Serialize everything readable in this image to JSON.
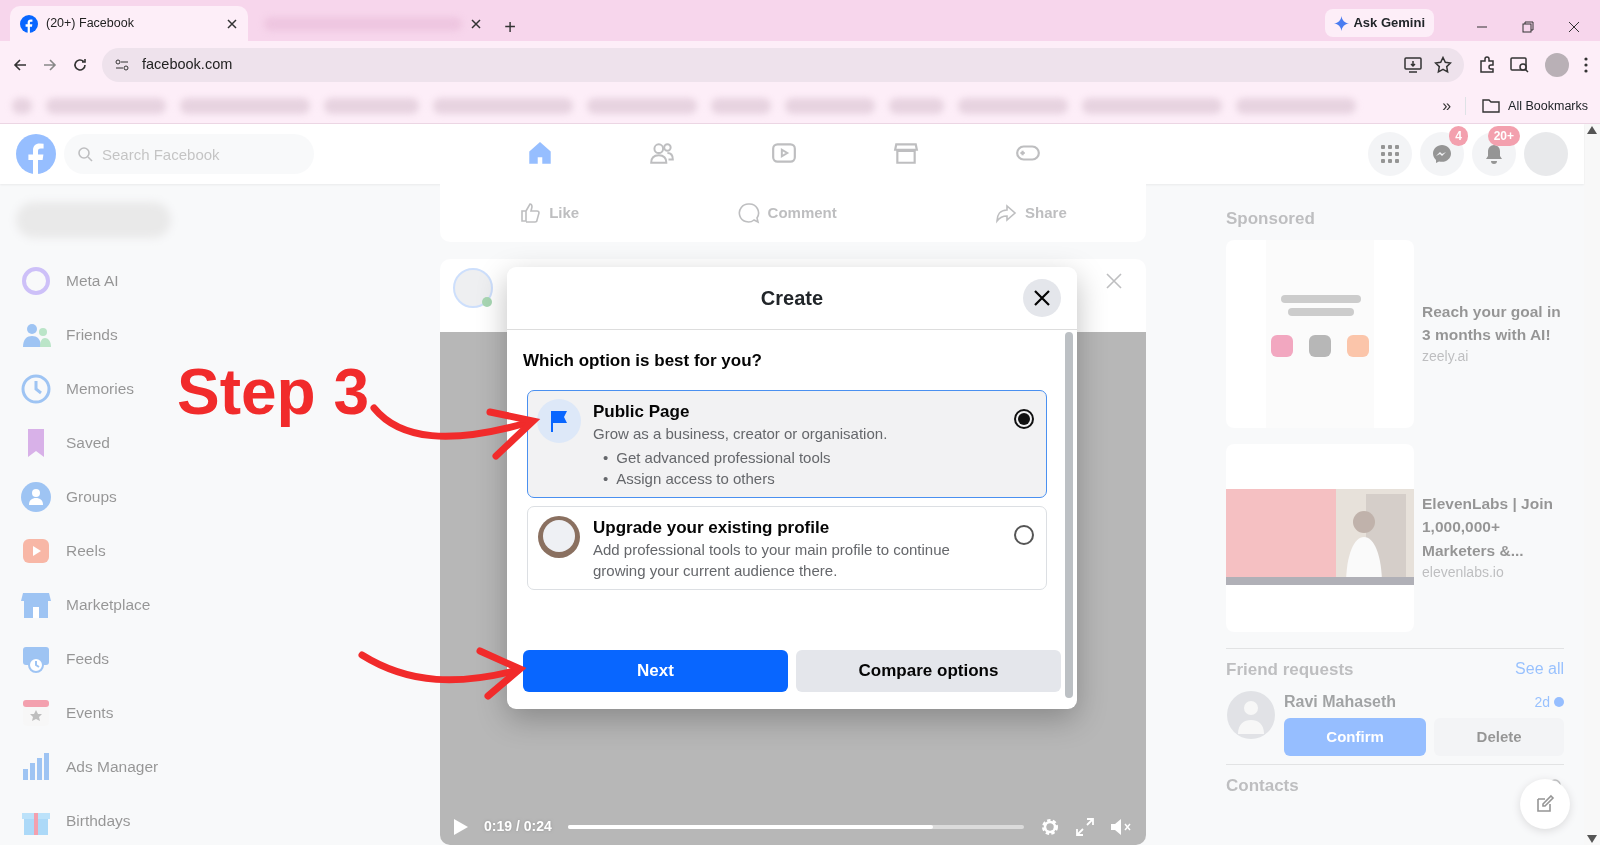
{
  "browser": {
    "tabs": [
      {
        "title": "(20+) Facebook",
        "selected": true
      },
      {
        "selected": false
      }
    ],
    "new_tab": "+",
    "ask_gemini": "Ask Gemini",
    "url": "facebook.com",
    "more_bookmarks": "»",
    "all_bookmarks": "All Bookmarks"
  },
  "header": {
    "search": {
      "placeholder": "Search Facebook"
    },
    "nav": [
      {
        "kind": "home",
        "selected": true
      },
      {
        "kind": "friends",
        "selected": false
      },
      {
        "kind": "video",
        "selected": false
      },
      {
        "kind": "marketplace",
        "selected": false
      },
      {
        "kind": "gaming",
        "selected": false
      }
    ],
    "messenger_badge": "4",
    "notifications_badge": "20+"
  },
  "sidebar": {
    "items": [
      {
        "kind": "meta_ai",
        "label": "Meta AI"
      },
      {
        "kind": "friends",
        "label": "Friends"
      },
      {
        "kind": "memories",
        "label": "Memories"
      },
      {
        "kind": "saved",
        "label": "Saved"
      },
      {
        "kind": "groups",
        "label": "Groups"
      },
      {
        "kind": "reels",
        "label": "Reels"
      },
      {
        "kind": "marketplace",
        "label": "Marketplace"
      },
      {
        "kind": "feeds",
        "label": "Feeds"
      },
      {
        "kind": "events",
        "label": "Events"
      },
      {
        "kind": "ads",
        "label": "Ads Manager"
      },
      {
        "kind": "birthdays",
        "label": "Birthdays"
      }
    ]
  },
  "feed": {
    "post_actions": [
      {
        "kind": "like",
        "label": "Like"
      },
      {
        "kind": "comment",
        "label": "Comment"
      },
      {
        "kind": "share",
        "label": "Share"
      }
    ],
    "video": {
      "time": "0:19 / 0:24",
      "level": 0.8
    }
  },
  "right": {
    "sponsored": "Sponsored",
    "ads": [
      {
        "title": "Reach your goal in 3 months with AI!",
        "domain": "zeely.ai"
      },
      {
        "title": "ElevenLabs | Join 1,000,000+ Marketers &...",
        "domain": "elevenlabs.io"
      }
    ],
    "friend_requests": {
      "title": "Friend requests",
      "see_all": "See all",
      "name": "Ravi Mahaseth",
      "time": "2d",
      "confirm": "Confirm",
      "delete": "Delete"
    },
    "contacts": "Contacts"
  },
  "annotation": {
    "text": "Step 3"
  },
  "dialog": {
    "title": "Create",
    "question": "Which option is best for you?",
    "options": [
      {
        "kind": "page",
        "title": "Public Page",
        "description": "Grow as a business, creator or organisation.",
        "bullet_marker": "•",
        "bullets": [
          "Get advanced professional tools",
          "Assign access to others"
        ],
        "selected": true
      },
      {
        "kind": "profile",
        "title": "Upgrade your existing profile",
        "description": "Add professional tools to your main profile to continue growing your current audience there.",
        "selected": false
      }
    ],
    "buttons": [
      {
        "kind": "primary",
        "label": "Next"
      },
      {
        "kind": "secondary",
        "label": "Compare options"
      }
    ]
  }
}
